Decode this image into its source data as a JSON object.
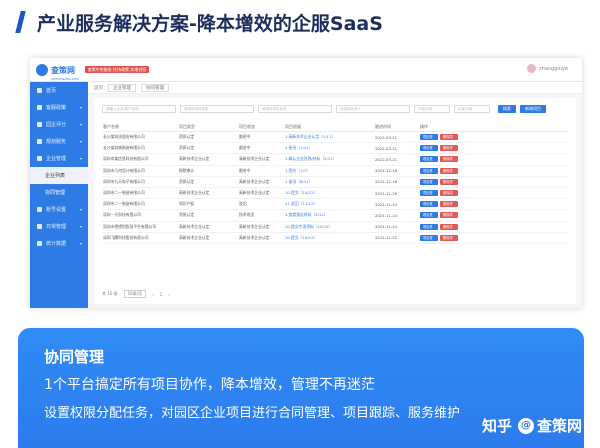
{
  "slide": {
    "title": "产业服务解决方案-降本增效的企服SaaS"
  },
  "app": {
    "logo": {
      "name": "查策网",
      "sub": "CHACEWANG.COM",
      "badge": "查策中央服务 扶持政策 实地对接"
    },
    "user": {
      "name": "zhangqiuye"
    },
    "sidebar": [
      {
        "label": "首页",
        "caret": ""
      },
      {
        "label": "客服政策",
        "caret": "▾"
      },
      {
        "label": "园企评分",
        "caret": "▾"
      },
      {
        "label": "规划服务",
        "caret": "▾"
      },
      {
        "label": "企业管理",
        "caret": "▾"
      }
    ],
    "sidebar_sub": [
      {
        "label": "企业列表",
        "state": "plain"
      },
      {
        "label": "协同管理",
        "state": "active"
      }
    ],
    "sidebar_more": [
      {
        "label": "账号设置",
        "caret": "▾"
      },
      {
        "label": "日常管理",
        "caret": "▾"
      },
      {
        "label": "统计数据",
        "caret": "▾"
      }
    ],
    "breadcrumb": [
      "首页",
      "企业管理",
      "协同管理"
    ],
    "filters": [
      "请输入企业/客户名称",
      "请选择项目类型",
      "请选择项目状态",
      "请选择负责人",
      "开始日期",
      "结束日期"
    ],
    "buttons": {
      "search": "搜索",
      "add": "新增项目"
    },
    "columns": [
      "客户名称",
      "项目类型",
      "项目状态",
      "项目进展",
      "跟进时间",
      "操作"
    ],
    "rows": [
      {
        "client": "长沙某科技股份有限公司",
        "type": "资质认定",
        "status": "跟进中",
        "progress": "1.高新技术企业认定（1/11）",
        "time": "2022-03-21"
      },
      {
        "client": "长沙某机械制造有限公司",
        "type": "资质认定",
        "status": "跟进中",
        "progress": "1.接洽（1/11）",
        "time": "2022-03-21"
      },
      {
        "client": "深圳市某信息科技有限公司",
        "type": "高新技术企业认定",
        "status": "高新技术企业认定",
        "progress": "1.确认企业名称/材料（2/11）",
        "time": "2022-03-21"
      },
      {
        "client": "深圳市几何设计有限公司",
        "type": "财税审计",
        "status": "跟进中",
        "progress": "1.签约（1/7）",
        "time": "2021-12-16"
      },
      {
        "client": "深圳市九天电子有限公司",
        "type": "资质认定",
        "status": "高新技术企业认定",
        "progress": "1.接洽（8/11）",
        "time": "2021-12-16"
      },
      {
        "client": "深圳市二一制造有限公司",
        "type": "高新技术企业认定",
        "status": "高新技术企业认定",
        "progress": "10.提交（10/12）",
        "time": "2021-11-26"
      },
      {
        "client": "深圳市二一制造有限公司",
        "type": "知识产权",
        "status": "驳回",
        "progress": "11.驳回（11/12）",
        "time": "2021-11-24"
      },
      {
        "client": "深圳一凡科技有限公司",
        "type": "资质认定",
        "status": "技术攻坚",
        "progress": "4.查看报告材料（4/11）",
        "time": "2021-11-24"
      },
      {
        "client": "深圳市德望恒智慧平台有限公司",
        "type": "高新技术企业认定",
        "status": "高新技术企业认定",
        "progress": "10.提交专项资料（10/12）",
        "time": "2021-11-24"
      },
      {
        "client": "深圳飞腾科技股份有限公司",
        "type": "高新技术企业认定",
        "status": "高新技术企业认定",
        "progress": "10.提交（10/12）",
        "time": "2021-11-22"
      }
    ],
    "row_actions": {
      "follow": "项目进度",
      "delete": "删除项目"
    },
    "pagination": {
      "total": "共 10 条",
      "size": "10条/页",
      "prev": "‹",
      "page": "1",
      "next": "›"
    }
  },
  "feature": {
    "title": "协同管理",
    "slogan": "1个平台搞定所有项目协作，降本增效，管理不再迷茫",
    "desc": "设置权限分配任务，对园区企业项目进行合同管理、项目跟踪、服务维护"
  },
  "watermark": {
    "prefix": "知乎",
    "at": "@",
    "name": "查策网"
  },
  "colors": {
    "primary": "#2f7be6",
    "danger": "#e15a5a",
    "title": "#1d2e5e"
  }
}
